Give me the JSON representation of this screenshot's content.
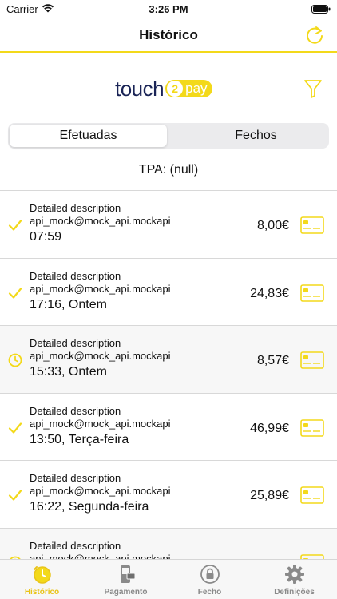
{
  "status_bar": {
    "carrier": "Carrier",
    "time": "3:26 PM"
  },
  "nav": {
    "title": "Histórico"
  },
  "brand": {
    "logo_text_left": "touch",
    "logo_badge": "2",
    "logo_text_right": "pay"
  },
  "segments": [
    {
      "label": "Efetuadas",
      "active": true
    },
    {
      "label": "Fechos",
      "active": false
    }
  ],
  "tpa_label": "TPA: (null)",
  "transactions": [
    {
      "status_icon": "check-icon",
      "description": "Detailed description",
      "user": "api_mock@mock_api.mockapi",
      "time": "07:59",
      "amount": "8,00€"
    },
    {
      "status_icon": "check-icon",
      "description": "Detailed description",
      "user": "api_mock@mock_api.mockapi",
      "time": "17:16, Ontem",
      "amount": "24,83€"
    },
    {
      "status_icon": "clock-icon",
      "description": "Detailed description",
      "user": "api_mock@mock_api.mockapi",
      "time": "15:33, Ontem",
      "amount": "8,57€"
    },
    {
      "status_icon": "check-icon",
      "description": "Detailed description",
      "user": "api_mock@mock_api.mockapi",
      "time": "13:50, Terça-feira",
      "amount": "46,99€"
    },
    {
      "status_icon": "check-icon",
      "description": "Detailed description",
      "user": "api_mock@mock_api.mockapi",
      "time": "16:22, Segunda-feira",
      "amount": "25,89€"
    },
    {
      "status_icon": "clock-icon",
      "description": "Detailed description",
      "user": "api_mock@mock_api.mockapi",
      "time": "",
      "amount": ""
    }
  ],
  "tabs": [
    {
      "label": "Histórico",
      "icon": "history-icon",
      "active": true
    },
    {
      "label": "Pagamento",
      "icon": "payment-icon",
      "active": false
    },
    {
      "label": "Fecho",
      "icon": "lock-icon",
      "active": false
    },
    {
      "label": "Definições",
      "icon": "gear-icon",
      "active": false
    }
  ],
  "colors": {
    "accent": "#f3d91a",
    "accent_dark": "#e9c419",
    "logo_navy": "#1a2456",
    "tab_inactive": "#8a8a8a"
  }
}
